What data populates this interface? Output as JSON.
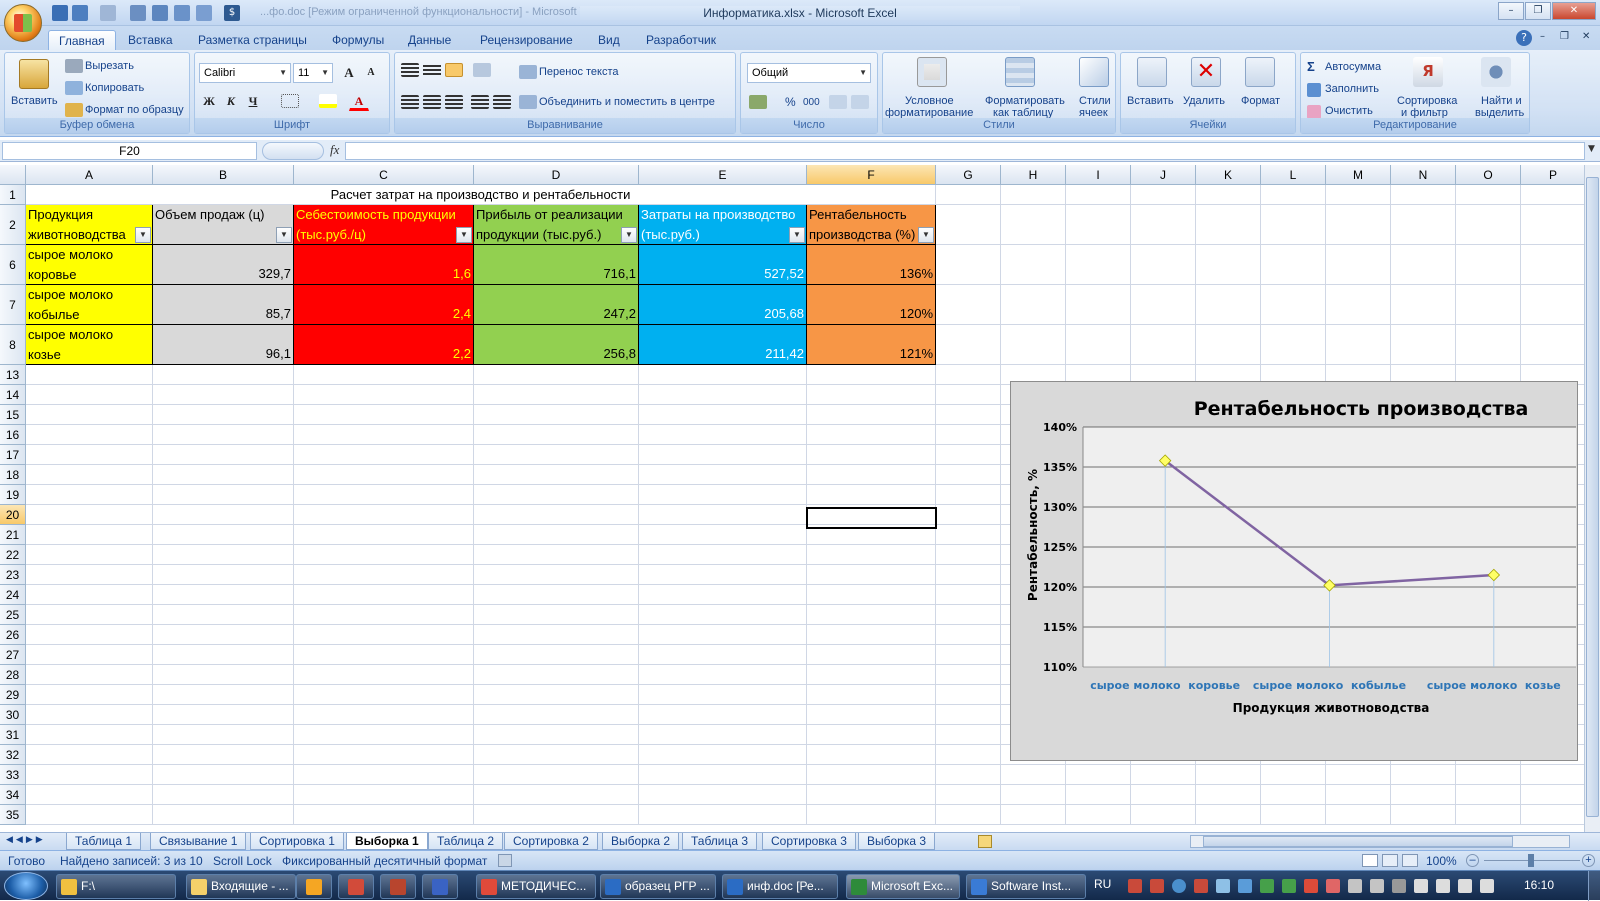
{
  "window": {
    "title": "Информатика.xlsx - Microsoft Excel",
    "doc_hint": "...фо.doc [Режим ограниченной функциональности] - Microsoft Word"
  },
  "ribbon_tabs": [
    "Главная",
    "Вставка",
    "Разметка страницы",
    "Формулы",
    "Данные",
    "Рецензирование",
    "Вид",
    "Разработчик"
  ],
  "ribbon": {
    "clipboard": {
      "paste": "Вставить",
      "cut": "Вырезать",
      "copy": "Копировать",
      "format_painter": "Формат по образцу",
      "label": "Буфер обмена"
    },
    "font": {
      "name": "Calibri",
      "size": "11",
      "bold": "Ж",
      "italic": "К",
      "underline": "Ч",
      "label": "Шрифт"
    },
    "alignment": {
      "wrap": "Перенос текста",
      "merge": "Объединить и поместить в центре",
      "label": "Выравнивание"
    },
    "number": {
      "format": "Общий",
      "percent": "%",
      "thousands": "000",
      "label": "Число"
    },
    "styles": {
      "conditional_1": "Условное",
      "conditional_2": "форматирование",
      "table_1": "Форматировать",
      "table_2": "как таблицу",
      "cell_1": "Стили",
      "cell_2": "ячеек",
      "label": "Стили"
    },
    "cells": {
      "insert": "Вставить",
      "delete": "Удалить",
      "format": "Формат",
      "label": "Ячейки"
    },
    "editing": {
      "autosum": "Автосумма",
      "fill": "Заполнить",
      "clear": "Очистить",
      "sort_1": "Сортировка",
      "sort_2": "и фильтр",
      "find_1": "Найти и",
      "find_2": "выделить",
      "label": "Редактирование"
    }
  },
  "formula_bar": {
    "name_box": "F20",
    "fx": "fx",
    "value": ""
  },
  "columns": [
    "A",
    "B",
    "C",
    "D",
    "E",
    "F",
    "G",
    "H",
    "I",
    "J",
    "K",
    "L",
    "M",
    "N",
    "O",
    "P"
  ],
  "sheet": {
    "title": "Расчет затрат на производство и рентабельности",
    "headers": [
      [
        "Продукция",
        "животноводства"
      ],
      [
        "",
        "Объем продаж (ц)"
      ],
      [
        "Себестоимость продукции",
        "(тыс.руб./ц)"
      ],
      [
        "Прибыль от реализации",
        "продукции (тыс.руб.)"
      ],
      [
        "Затраты на производство",
        "(тыс.руб.)"
      ],
      [
        "Рентабельность",
        "производства (%)"
      ]
    ],
    "rows": [
      {
        "num": "6",
        "name1": "сырое молоко",
        "name2": "коровье",
        "b": "329,7",
        "c": "1,6",
        "d": "716,1",
        "e": "527,52",
        "f": "136%"
      },
      {
        "num": "7",
        "name1": "сырое молоко",
        "name2": "кобылье",
        "b": "85,7",
        "c": "2,4",
        "d": "247,2",
        "e": "205,68",
        "f": "120%"
      },
      {
        "num": "8",
        "name1": "сырое молоко",
        "name2": "козье",
        "b": "96,1",
        "c": "2,2",
        "d": "256,8",
        "e": "211,42",
        "f": "121%"
      }
    ],
    "empty_rows": [
      "13",
      "14",
      "15",
      "16",
      "17",
      "18",
      "19",
      "20",
      "21",
      "22",
      "23",
      "24",
      "25",
      "26",
      "27",
      "28",
      "29",
      "30",
      "31",
      "32",
      "33",
      "34",
      "35"
    ]
  },
  "chart_data": {
    "type": "line",
    "title": "Рентабельность производства",
    "xlabel": "Продукция животноводства",
    "ylabel": "Рентабельность, %",
    "categories": [
      "сырое молоко  коровье",
      "сырое молоко  кобылье",
      "сырое молоко  козье"
    ],
    "series": [
      {
        "values": [
          135.8,
          120.2,
          121.5
        ]
      }
    ],
    "ylim": [
      110,
      140
    ],
    "yticks": [
      "110%",
      "115%",
      "120%",
      "125%",
      "130%",
      "135%",
      "140%"
    ],
    "line_color": "#8064a2",
    "marker_color": "#ffff66",
    "legend": "none",
    "grid": true
  },
  "sheet_tabs": [
    "Таблица 1",
    "Связывание 1",
    "Сортировка 1",
    "Выборка 1",
    "Таблица 2",
    "Сортировка 2",
    "Выборка 2",
    "Таблица 3",
    "Сортировка 3",
    "Выборка 3"
  ],
  "active_sheet": "Выборка 1",
  "status": {
    "ready": "Готово",
    "found": "Найдено записей: 3 из 10",
    "scroll": "Scroll Lock",
    "fixed": "Фиксированный десятичный формат",
    "zoom": "100%"
  },
  "taskbar": {
    "items": [
      "F:\\",
      "Входящие - ...",
      "МЕТОДИЧЕС...",
      "образец РГР ...",
      "инф.doc [Ре...",
      "Microsoft Exc...",
      "Software Inst..."
    ],
    "lang": "RU",
    "time": "16:10"
  },
  "colors": {
    "yellow": "#ffff00",
    "gray": "#d9d9d9",
    "red": "#ff0000",
    "green": "#92d050",
    "blue": "#00b0f0",
    "orange": "#f79646"
  }
}
